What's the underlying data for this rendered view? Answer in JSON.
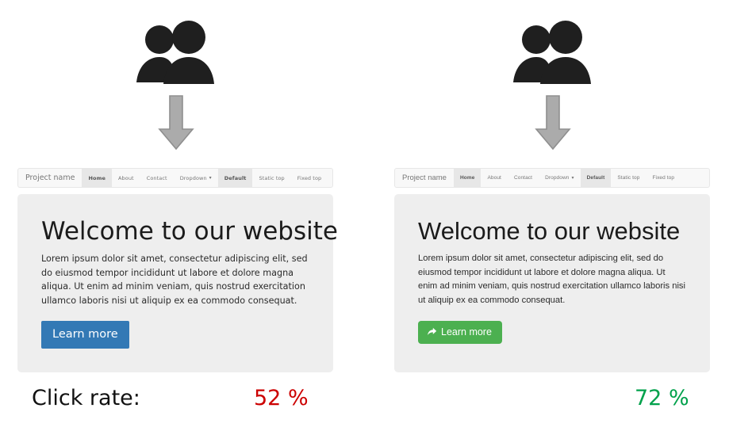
{
  "page": {
    "background": "#ffffff",
    "comparison_type": "a-b-test-click-rate"
  },
  "icons": {
    "people": "people-group-icon",
    "arrow": "down-arrow-icon",
    "button_glyph": "share-arrow-icon",
    "caret": "▾"
  },
  "variants": [
    {
      "id": "variant-a",
      "side": "left",
      "navbar": {
        "brand": "Project name",
        "items": [
          {
            "label": "Home",
            "active": true
          },
          {
            "label": "About",
            "active": false
          },
          {
            "label": "Contact",
            "active": false
          },
          {
            "label": "Dropdown",
            "active": false,
            "caret": true
          },
          {
            "label": "Default",
            "active": true
          },
          {
            "label": "Static top",
            "active": false
          },
          {
            "label": "Fixed top",
            "active": false
          }
        ]
      },
      "hero": {
        "title": "Welcome to our website",
        "body": "Lorem ipsum dolor sit amet, consectetur adipiscing elit, sed do eiusmod tempor incididunt ut labore et dolore magna aliqua. Ut enim ad minim veniam, quis nostrud exercitation ullamco laboris nisi ut aliquip ex ea commodo consequat.",
        "cta_label": "Learn more",
        "cta_color": "#3379b5",
        "cta_has_icon": false
      },
      "metric": {
        "label": "Click rate:",
        "value": "52 %",
        "color": "#cc0000"
      }
    },
    {
      "id": "variant-b",
      "side": "right",
      "navbar": {
        "brand": "Project name",
        "items": [
          {
            "label": "Home",
            "active": true
          },
          {
            "label": "About",
            "active": false
          },
          {
            "label": "Contact",
            "active": false
          },
          {
            "label": "Dropdown",
            "active": false,
            "caret": true
          },
          {
            "label": "Default",
            "active": true
          },
          {
            "label": "Static top",
            "active": false
          },
          {
            "label": "Fixed top",
            "active": false
          }
        ]
      },
      "hero": {
        "title": "Welcome to our website",
        "body": "Lorem ipsum dolor sit amet, consectetur adipiscing elit, sed do eiusmod tempor incididunt ut labore et dolore magna aliqua. Ut enim ad minim veniam, quis nostrud exercitation ullamco laboris nisi ut aliquip ex ea commodo consequat.",
        "cta_label": "Learn more",
        "cta_color": "#4cb050",
        "cta_has_icon": true
      },
      "metric": {
        "label": "",
        "value": "72 %",
        "color": "#00a14b"
      }
    }
  ]
}
